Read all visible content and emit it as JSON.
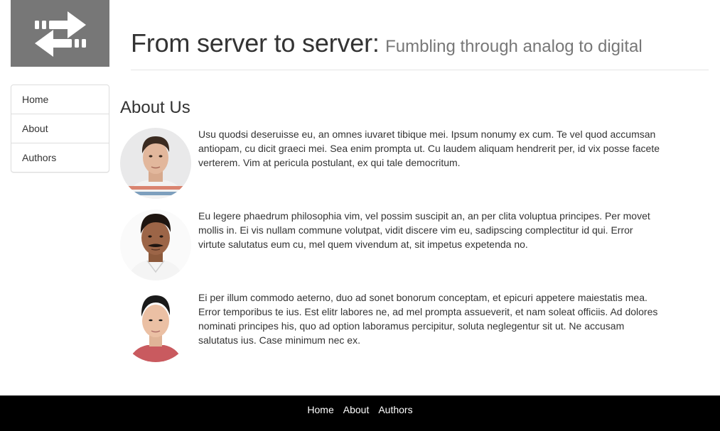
{
  "site": {
    "title": "From server to server:",
    "subtitle": "Fumbling through analog to digital",
    "logo_icon": "swap-arrows-icon"
  },
  "sidebar": {
    "items": [
      {
        "label": "Home"
      },
      {
        "label": "About"
      },
      {
        "label": "Authors"
      }
    ]
  },
  "main": {
    "heading": "About Us",
    "members": [
      {
        "bio": "Usu quodsi deseruisse eu, an omnes iuvaret tibique mei. Ipsum nonumy ex cum. Te vel quod accumsan antiopam, cu dicit graeci mei. Sea enim prompta ut. Cu laudem aliquam hendrerit per, id vix posse facete verterem. Vim at pericula postulant, ex qui tale democritum."
      },
      {
        "bio": "Eu legere phaedrum philosophia vim, vel possim suscipit an, an per clita voluptua principes. Per movet mollis in. Ei vis nullam commune volutpat, vidit discere vim eu, sadipscing complectitur id qui. Error virtute salutatus eum cu, mel quem vivendum at, sit impetus expetenda no."
      },
      {
        "bio": "Ei per illum commodo aeterno, duo ad sonet bonorum conceptam, et epicuri appetere maiestatis mea. Error temporibus te ius. Est elitr labores ne, ad mel prompta assueverit, et nam soleat officiis. Ad dolores nominati principes his, quo ad option laboramus percipitur, soluta neglegentur sit ut. Ne accusam salutatus ius. Case minimum nec ex."
      }
    ]
  },
  "footer": {
    "links": [
      {
        "label": "Home"
      },
      {
        "label": "About"
      },
      {
        "label": "Authors"
      }
    ]
  },
  "colors": {
    "logo_bg": "#777777",
    "footer_bg": "#000000",
    "text": "#333333",
    "subtitle": "#777777"
  }
}
